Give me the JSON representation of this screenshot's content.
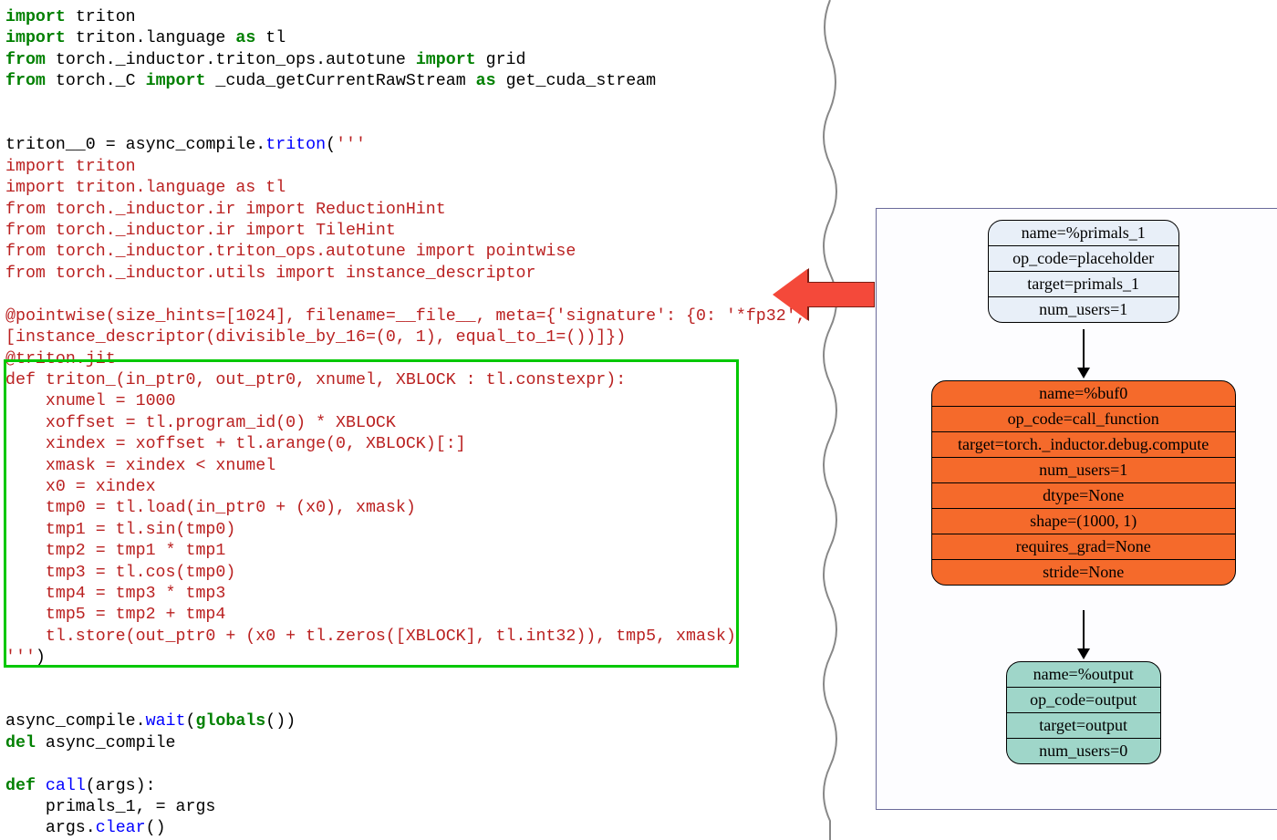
{
  "code": {
    "l1": {
      "kw1": "import",
      "sp": " ",
      "nm": "triton"
    },
    "l2": {
      "kw1": "import",
      "sp": " ",
      "nm": "triton.language",
      "sp2": " ",
      "kw2": "as",
      "sp3": " ",
      "nm2": "tl"
    },
    "l3": {
      "kw1": "from",
      "nm": " torch._inductor.triton_ops.autotune ",
      "kw2": "import",
      "nm2": " grid"
    },
    "l4": {
      "kw1": "from",
      "nm": " torch._C ",
      "kw2": "import",
      "nm2": " _cuda_getCurrentRawStream ",
      "kw3": "as",
      "nm3": " get_cuda_stream"
    },
    "l6a": "triton__0 ",
    "l6b": "=",
    "l6c": " async_compile.",
    "l6d": "triton",
    "l6e": "(",
    "l6f": "'''",
    "s1": "import triton",
    "s2": "import triton.language as tl",
    "s3": "from torch._inductor.ir import ReductionHint",
    "s4": "from torch._inductor.ir import TileHint",
    "s5": "from torch._inductor.triton_ops.autotune import pointwise",
    "s6": "from torch._inductor.utils import instance_descriptor",
    "s7": "",
    "s8": "@pointwise(size_hints=[1024], filename=__file__, meta={'signature': {0: '*fp32',",
    "s9": "[instance_descriptor(divisible_by_16=(0, 1), equal_to_1=())]})",
    "s10": "@triton.jit",
    "s11": "def triton_(in_ptr0, out_ptr0, xnumel, XBLOCK : tl.constexpr):",
    "s12": "    xnumel = 1000",
    "s13": "    xoffset = tl.program_id(0) * XBLOCK",
    "s14": "    xindex = xoffset + tl.arange(0, XBLOCK)[:]",
    "s15": "    xmask = xindex < xnumel",
    "s16": "    x0 = xindex",
    "s17": "    tmp0 = tl.load(in_ptr0 + (x0), xmask)",
    "s18": "    tmp1 = tl.sin(tmp0)",
    "s19": "    tmp2 = tmp1 * tmp1",
    "s20": "    tmp3 = tl.cos(tmp0)",
    "s21": "    tmp4 = tmp3 * tmp3",
    "s22": "    tmp5 = tmp2 + tmp4",
    "s23": "    tl.store(out_ptr0 + (x0 + tl.zeros([XBLOCK], tl.int32)), tmp5, xmask)",
    "s24": "'''",
    "l8a": "async_compile.",
    "l8b": "wait",
    "l8c": "(",
    "l8d": "globals",
    "l8e": "())",
    "l9a": "del",
    "l9b": " async_compile",
    "l10a": "def",
    "l10b": " ",
    "l10c": "call",
    "l10d": "(args):",
    "l11": "    primals_1, ",
    "l11b": "=",
    "l11c": " args",
    "l12": "    args",
    "l12b": ".",
    "l12c": "clear",
    "l12d": "()"
  },
  "graph": {
    "n1": {
      "r1": "name=%primals_1",
      "r2": "op_code=placeholder",
      "r3": "target=primals_1",
      "r4": "num_users=1"
    },
    "n2": {
      "r1": "name=%buf0",
      "r2": "op_code=call_function",
      "r3": "target=torch._inductor.debug.compute",
      "r4": "num_users=1",
      "r5": "dtype=None",
      "r6": "shape=(1000, 1)",
      "r7": "requires_grad=None",
      "r8": "stride=None"
    },
    "n3": {
      "r1": "name=%output",
      "r2": "op_code=output",
      "r3": "target=output",
      "r4": "num_users=0"
    }
  }
}
